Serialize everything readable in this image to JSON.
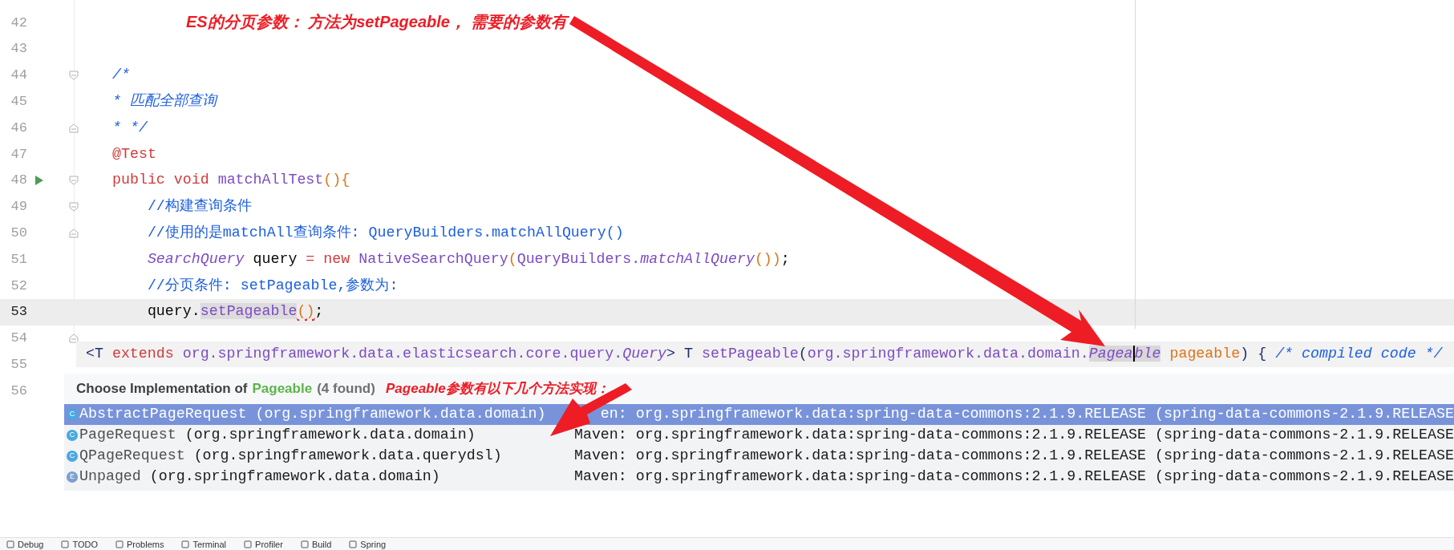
{
  "editor": {
    "lines": [
      {
        "number": "42",
        "current": false,
        "run_marker": false
      },
      {
        "number": "43",
        "current": false,
        "run_marker": false
      },
      {
        "number": "44",
        "current": false,
        "run_marker": false,
        "fold_start": true,
        "tokens": [
          {
            "text": "/*",
            "kind": "commentitalic"
          }
        ]
      },
      {
        "number": "45",
        "current": false,
        "run_marker": false,
        "tokens": [
          {
            "text": "* 匹配全部查询",
            "kind": "commentitalic"
          }
        ]
      },
      {
        "number": "46",
        "current": false,
        "run_marker": false,
        "fold_end": true,
        "tokens": [
          {
            "text": "* */",
            "kind": "commentitalic"
          }
        ]
      },
      {
        "number": "47",
        "current": false,
        "run_marker": false,
        "tokens": [
          {
            "text": "@Test",
            "kind": "keyword"
          }
        ]
      },
      {
        "number": "48",
        "current": false,
        "run_marker": true,
        "fold_start": true,
        "tokens": [
          {
            "text": "public void ",
            "kind": "keyword"
          },
          {
            "text": "matchAllTest",
            "kind": "method"
          },
          {
            "text": "(){",
            "kind": "paren"
          }
        ]
      },
      {
        "number": "49",
        "current": false,
        "run_marker": false,
        "fold_start": true,
        "tokens": [
          {
            "text": "    //构建查询条件",
            "kind": "comment"
          }
        ]
      },
      {
        "number": "50",
        "current": false,
        "run_marker": false,
        "fold_end": true,
        "tokens": [
          {
            "text": "    //使用的是matchAll查询条件: QueryBuilders.matchAllQuery()",
            "kind": "comment"
          }
        ]
      },
      {
        "number": "51",
        "current": false,
        "run_marker": false,
        "tokens": [
          {
            "text": "    SearchQuery",
            "kind": "methoditalic"
          },
          {
            "text": " query ",
            "kind": "plain"
          },
          {
            "text": "= new ",
            "kind": "keyword"
          },
          {
            "text": "NativeSearchQuery",
            "kind": "method"
          },
          {
            "text": "(",
            "kind": "paren"
          },
          {
            "text": "QueryBuilders.",
            "kind": "method"
          },
          {
            "text": "matchAllQuery",
            "kind": "methoditalic"
          },
          {
            "text": "())",
            "kind": "paren"
          },
          {
            "text": ";",
            "kind": "plain"
          }
        ]
      },
      {
        "number": "52",
        "current": false,
        "run_marker": false,
        "tokens": [
          {
            "text": "    //分页条件: setPageable,参数为:",
            "kind": "comment"
          }
        ]
      },
      {
        "number": "53",
        "current": true,
        "run_marker": false,
        "tokens": [
          {
            "text": "    query.",
            "kind": "plain"
          },
          {
            "text": "setPageable",
            "kind": "methodhl"
          },
          {
            "text": "()",
            "kind": "parenerror"
          },
          {
            "text": ";",
            "kind": "plain"
          }
        ]
      },
      {
        "number": "54",
        "current": false,
        "run_marker": false,
        "fold_end": true
      },
      {
        "number": "55",
        "current": false,
        "run_marker": false
      },
      {
        "number": "56",
        "current": false,
        "run_marker": false
      }
    ]
  },
  "signature_popup": {
    "tokens": [
      {
        "text": "<T ",
        "kind": "dark"
      },
      {
        "text": "extends ",
        "kind": "keyword"
      },
      {
        "text": "org.springframework.data.elasticsearch.core.query.",
        "kind": "method"
      },
      {
        "text": "Query",
        "kind": "methoditalic"
      },
      {
        "text": "> T ",
        "kind": "dark"
      },
      {
        "text": "setPageable",
        "kind": "method"
      },
      {
        "text": "(",
        "kind": "dark"
      },
      {
        "text": "org.springframework.data.domain.",
        "kind": "method"
      },
      {
        "text": "Pagea",
        "kind": "italichlcaret"
      },
      {
        "text": "ble",
        "kind": "italichl"
      },
      {
        "text": " pageable",
        "kind": "paren"
      },
      {
        "text": ") { ",
        "kind": "dark"
      },
      {
        "text": "/* compiled code */",
        "kind": "commentitalic"
      }
    ]
  },
  "chooser": {
    "title": "Choose Implementation of",
    "type_name": "Pageable",
    "count": "(4 found)",
    "items": [
      {
        "kind": "class",
        "icon": "C",
        "name": "AbstractPageRequest",
        "package": "(org.springframework.data.domain)",
        "location": "en: org.springframework.data:spring-data-commons:2.1.9.RELEASE (spring-data-commons-2.1.9.RELEASE",
        "selected": true
      },
      {
        "kind": "class",
        "icon": "C",
        "name": "PageRequest",
        "package": "(org.springframework.data.domain)",
        "location": "Maven: org.springframework.data:spring-data-commons:2.1.9.RELEASE (spring-data-commons-2.1.9.RELEASE",
        "selected": false
      },
      {
        "kind": "class",
        "icon": "C",
        "name": "QPageRequest",
        "package": "(org.springframework.data.querydsl)",
        "location": "Maven: org.springframework.data:spring-data-commons:2.1.9.RELEASE (spring-data-commons-2.1.9.RELEASE",
        "selected": false
      },
      {
        "kind": "enum",
        "icon": "E",
        "name": "Unpaged",
        "package": "(org.springframework.data.domain)",
        "location": "Maven: org.springframework.data:spring-data-commons:2.1.9.RELEASE (spring-data-commons-2.1.9.RELEASE",
        "selected": false
      }
    ]
  },
  "annotations": [
    {
      "text": "ES的分页参数： 方法为setPageable， 需要的参数有"
    },
    {
      "text": "Pageable参数有以下几个方法实现："
    }
  ],
  "tool_windows": [
    "Debug",
    "TODO",
    "Problems",
    "Terminal",
    "Profiler",
    "Build",
    "Spring"
  ]
}
